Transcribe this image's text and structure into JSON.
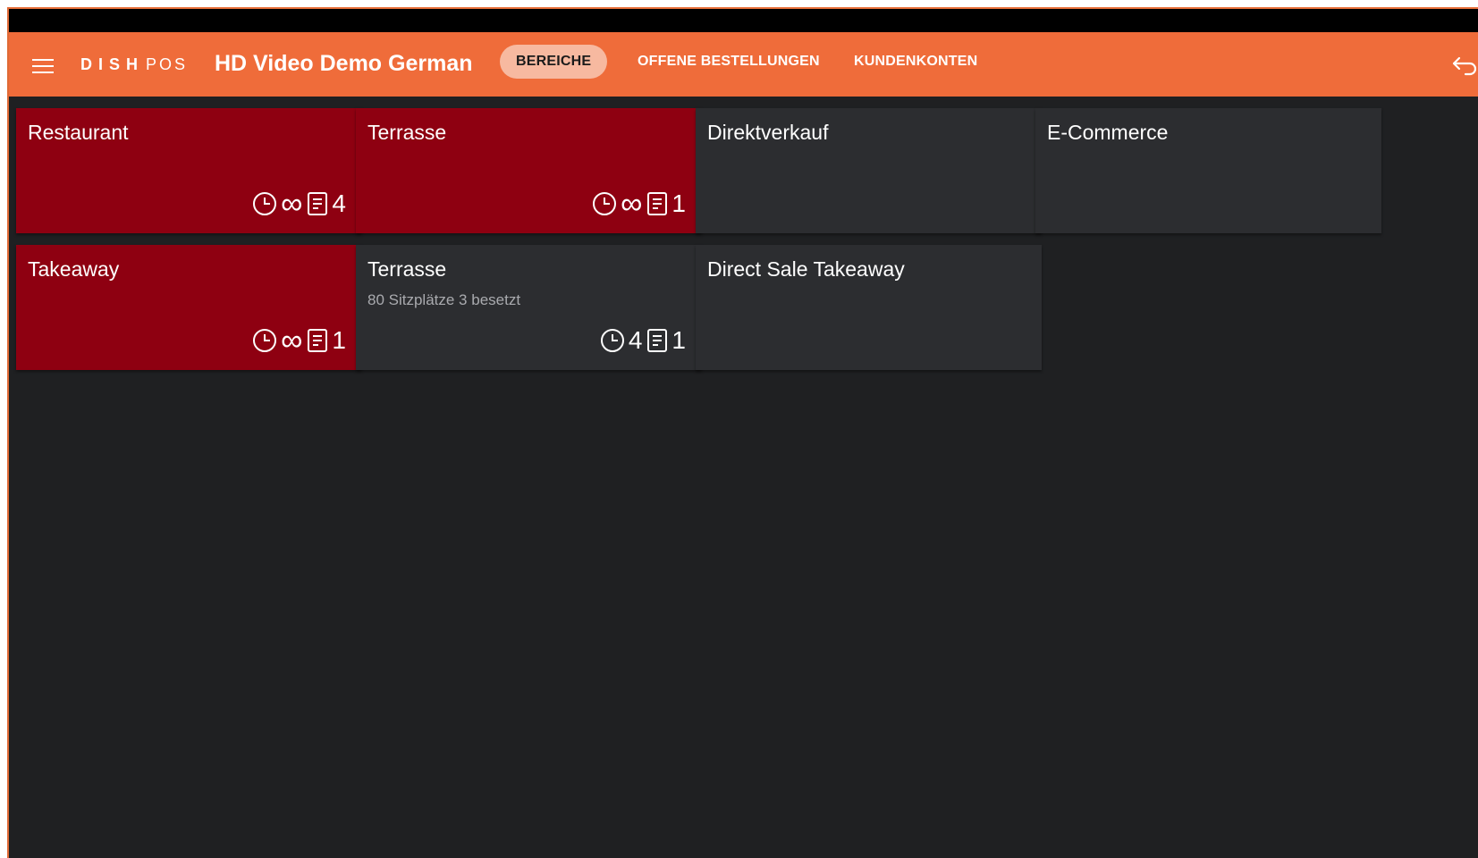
{
  "app": {
    "brand_word": "DISH",
    "brand_suffix": "POS",
    "venue_name": "HD Video Demo German"
  },
  "nav": {
    "tabs": [
      {
        "label": "BEREICHE",
        "active": true
      },
      {
        "label": "OFFENE BESTELLUNGEN",
        "active": false
      },
      {
        "label": "KUNDENKONTEN",
        "active": false
      }
    ]
  },
  "colors": {
    "accent": "#ef6c3a",
    "occupied_tile": "#8e0011",
    "free_tile": "#2c2d30",
    "background": "#1f2022"
  },
  "areas": [
    {
      "name": "Restaurant",
      "subtitle": "",
      "time": "∞",
      "orders": "4",
      "occupied": true
    },
    {
      "name": "Terrasse",
      "subtitle": "",
      "time": "∞",
      "orders": "1",
      "occupied": true
    },
    {
      "name": "Direktverkauf",
      "subtitle": "",
      "occupied": false
    },
    {
      "name": "E-Commerce",
      "subtitle": "",
      "occupied": false
    },
    {
      "name": "Takeaway",
      "subtitle": "",
      "time": "∞",
      "orders": "1",
      "occupied": true
    },
    {
      "name": "Terrasse",
      "subtitle": "80 Sitzplätze 3 besetzt",
      "time": "4",
      "orders": "1",
      "occupied": false
    },
    {
      "name": "Direct Sale Takeaway",
      "subtitle": "",
      "occupied": false
    }
  ],
  "icons": {
    "menu": "menu-icon",
    "back": "back-icon",
    "time": "clock-icon",
    "orders": "receipt-icon"
  }
}
